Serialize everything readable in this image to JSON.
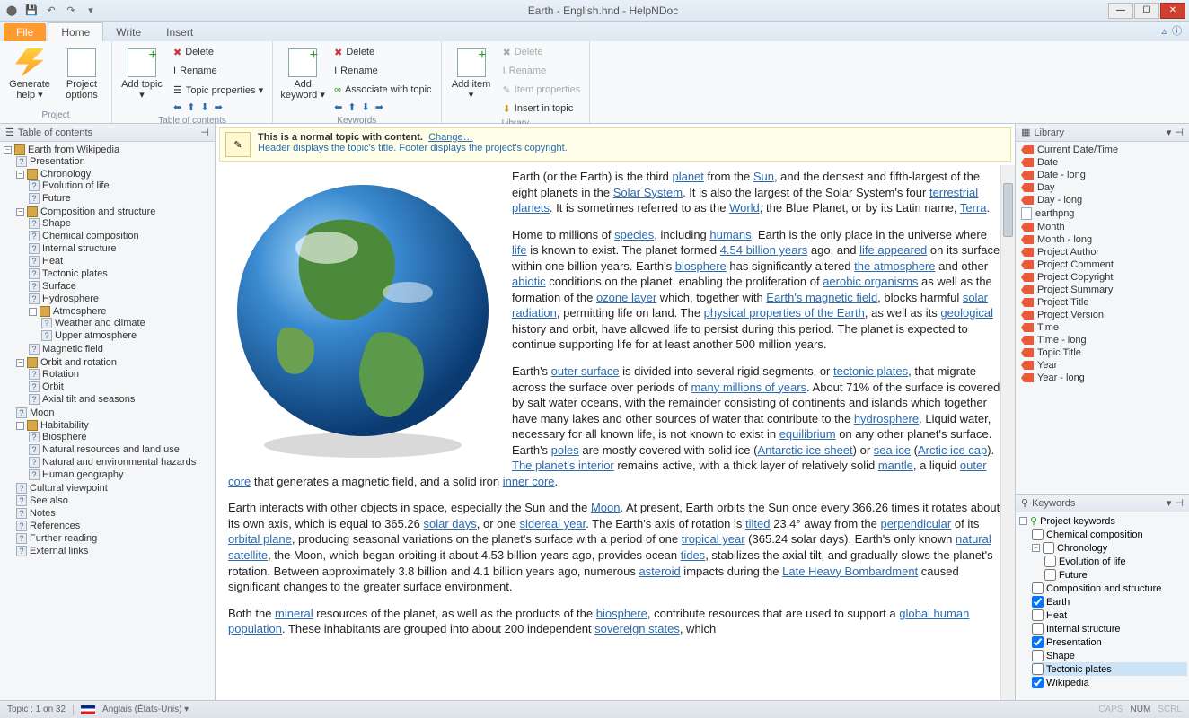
{
  "title": "Earth - English.hnd - HelpNDoc",
  "tabs": {
    "file": "File",
    "home": "Home",
    "write": "Write",
    "insert": "Insert"
  },
  "ribbon": {
    "project": {
      "label": "Project",
      "generate": "Generate help ▾",
      "options": "Project options"
    },
    "toc_group": {
      "label": "Table of contents",
      "add": "Add topic ▾",
      "delete": "Delete",
      "rename": "Rename",
      "props": "Topic properties ▾"
    },
    "kw_group": {
      "label": "Keywords",
      "add": "Add keyword ▾",
      "delete": "Delete",
      "rename": "Rename",
      "assoc": "Associate with topic"
    },
    "lib_group": {
      "label": "Library",
      "add": "Add item ▾",
      "delete": "Delete",
      "rename": "Rename",
      "props": "Item properties",
      "insert": "Insert in topic"
    }
  },
  "toc_panel_title": "Table of contents",
  "toc": {
    "root": "Earth from Wikipedia",
    "presentation": "Presentation",
    "chronology": "Chronology",
    "evolution": "Evolution of life",
    "future": "Future",
    "comp": "Composition and structure",
    "shape": "Shape",
    "chem": "Chemical composition",
    "internal": "Internal structure",
    "heat": "Heat",
    "tectonic": "Tectonic plates",
    "surface": "Surface",
    "hydro": "Hydrosphere",
    "atmo": "Atmosphere",
    "weather": "Weather and climate",
    "upper": "Upper atmosphere",
    "magnetic": "Magnetic field",
    "orbit": "Orbit and rotation",
    "rotation": "Rotation",
    "orbit2": "Orbit",
    "axial": "Axial tilt and seasons",
    "moon": "Moon",
    "habit": "Habitability",
    "bio": "Biosphere",
    "natres": "Natural resources and land use",
    "nathaz": "Natural and environmental hazards",
    "humgeo": "Human geography",
    "cultural": "Cultural viewpoint",
    "seealso": "See also",
    "notes": "Notes",
    "refs": "References",
    "further": "Further reading",
    "extlinks": "External links"
  },
  "notice": {
    "line1a": "This is a normal topic with content.",
    "line1b": "Change…",
    "line2": "Header displays the topic's title.   Footer displays the project's copyright."
  },
  "content": {
    "p1_a": "Earth (or the Earth) is the third ",
    "planet": "planet",
    "p1_b": " from the ",
    "sun": "Sun",
    "p1_c": ", and the densest and fifth-largest of the eight planets in the ",
    "solar": "Solar System",
    "p1_d": ". It is also the largest of the Solar System's four ",
    "terr": "terrestrial planets",
    "p1_e": ". It is sometimes referred to as the ",
    "world": "World",
    "p1_f": ", the Blue Planet, or by its Latin name, ",
    "terra": "Terra",
    "p1_g": ".",
    "p2_a": "Home to millions of ",
    "species": "species",
    "p2_b": ", including ",
    "humans": "humans",
    "p2_c": ", Earth is the only place in the universe where ",
    "life": "life",
    "p2_d": " is known to exist. The planet formed ",
    "byr": "4.54 billion years",
    "p2_e": " ago, and ",
    "lifeapp": "life appeared",
    "p2_f": " on its surface within one billion years. Earth's ",
    "biosphere": "biosphere",
    "p2_g": " has significantly altered ",
    "atmo": "the atmosphere",
    "p2_h": " and other ",
    "abiotic": "abiotic",
    "p2_i": " conditions on the planet, enabling the proliferation of ",
    "aerobic": "aerobic organisms",
    "p2_j": " as well as the formation of the ",
    "ozone": "ozone layer",
    "p2_k": " which, together with ",
    "mag": "Earth's magnetic field",
    "p2_l": ", blocks harmful ",
    "solrad": "solar radiation",
    "p2_m": ", permitting life on land. The ",
    "phys": "physical properties of the Earth",
    "p2_n": ", as well as its ",
    "geo": "geological",
    "p2_o": " history and orbit, have allowed life to persist during this period. The planet is expected to continue supporting life for at least another 500 million years.",
    "p3_a": "Earth's ",
    "outer": "outer surface",
    "p3_b": " is divided into several rigid segments, or ",
    "tect": "tectonic plates",
    "p3_c": ", that migrate across the surface over periods of ",
    "mmyr": "many millions of years",
    "p3_d": ". About 71% of the surface is covered by salt water oceans, with the remainder consisting of continents and islands which together have many lakes and other sources of water that contribute to the ",
    "hydro": "hydrosphere",
    "p3_e": ". Liquid water, necessary for all known life, is not known to exist in ",
    "equil": "equilibrium",
    "p3_f": " on any other planet's surface. Earth's ",
    "poles": "poles",
    "p3_g": " are mostly covered with solid ice (",
    "antice": "Antarctic ice sheet",
    "p3_h": ") or ",
    "seaice": "sea ice",
    "p3_i": " (",
    "arctic": "Arctic ice cap",
    "p3_j": "). ",
    "interior": "The planet's interior",
    "p3_k": " remains active, with a thick layer of relatively solid ",
    "mantle": "mantle",
    "p3_l": ", a liquid ",
    "outcore": "outer core",
    "p3_m": " that generates a magnetic field, and a solid iron ",
    "incore": "inner core",
    "p3_n": ".",
    "p4_a": "Earth interacts with other objects in space, especially the Sun and the ",
    "moon": "Moon",
    "p4_b": ". At present, Earth orbits the Sun once every 366.26 times it rotates about its own axis, which is equal to 365.26 ",
    "solard": "solar days",
    "p4_c": ", or one ",
    "sider": "sidereal year",
    "p4_d": ". The Earth's axis of rotation is ",
    "tilted": "tilted",
    "p4_e": " 23.4° away from the ",
    "perp": "perpendicular",
    "p4_f": " of its ",
    "orbital": "orbital plane",
    "p4_g": ", producing seasonal variations on the planet's surface with a period of one ",
    "trop": "tropical year",
    "p4_h": " (365.24 solar days). Earth's only known ",
    "natsat": "natural satellite",
    "p4_i": ", the Moon, which began orbiting it about 4.53 billion years ago, provides ocean ",
    "tides": "tides",
    "p4_j": ", stabilizes the axial tilt, and gradually slows the planet's rotation. Between approximately 3.8 billion and 4.1 billion years ago, numerous ",
    "asteroid": "asteroid",
    "p4_k": " impacts during the ",
    "lhb": "Late Heavy Bombardment",
    "p4_l": " caused significant changes to the greater surface environment.",
    "p5_a": "Both the ",
    "mineral": "mineral",
    "p5_b": " resources of the planet, as well as the products of the ",
    "bio2": "biosphere",
    "p5_c": ", contribute resources that are used to support a ",
    "ghp": "global human population",
    "p5_d": ". These inhabitants are grouped into about 200 independent ",
    "sov": "sovereign states",
    "p5_e": ", which"
  },
  "lib_panel_title": "Library",
  "library": [
    "Current Date/Time",
    "Date",
    "Date - long",
    "Day",
    "Day - long",
    "earthpng",
    "Month",
    "Month - long",
    "Project Author",
    "Project Comment",
    "Project Copyright",
    "Project Summary",
    "Project Title",
    "Project Version",
    "Time",
    "Time - long",
    "Topic Title",
    "Year",
    "Year - long"
  ],
  "kw_panel_title": "Keywords",
  "kw": {
    "root": "Project keywords",
    "chem": "Chemical composition",
    "chron": "Chronology",
    "evol": "Evolution of life",
    "future": "Future",
    "comp": "Composition and structure",
    "earth": "Earth",
    "heat": "Heat",
    "internal": "Internal structure",
    "pres": "Presentation",
    "shape": "Shape",
    "tect": "Tectonic plates",
    "wiki": "Wikipedia"
  },
  "status": {
    "topic": "Topic : 1 on 32",
    "lang": "Anglais (États-Unis) ▾",
    "caps": "CAPS",
    "num": "NUM",
    "scrl": "SCRL"
  }
}
